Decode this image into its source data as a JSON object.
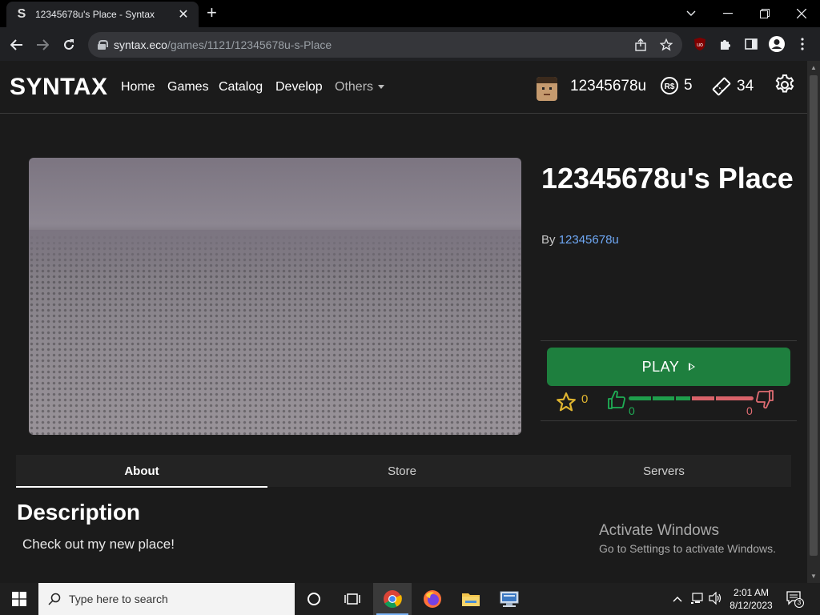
{
  "browser": {
    "tab_title": "12345678u's Place - Syntax",
    "tab_favicon": "S",
    "url_host": "syntax.eco",
    "url_path": "/games/1121/12345678u-s-Place"
  },
  "site": {
    "logo": "SYNTAX",
    "nav": [
      "Home",
      "Games",
      "Catalog",
      "Develop",
      "Others"
    ],
    "username": "12345678u",
    "robux": "5",
    "tix": "34"
  },
  "game": {
    "title": "12345678u's Place",
    "by_label": "By",
    "creator": "12345678u",
    "play_label": "PLAY",
    "favorites": "0",
    "upvotes": "0",
    "downvotes": "0"
  },
  "tabs": [
    "About",
    "Store",
    "Servers"
  ],
  "description": {
    "heading": "Description",
    "text": "Check out my new place!"
  },
  "watermark": {
    "line1": "Activate Windows",
    "line2": "Go to Settings to activate Windows."
  },
  "taskbar": {
    "search_placeholder": "Type here to search",
    "time": "2:01 AM",
    "date": "8/12/2023",
    "notifications": "3"
  },
  "colors": {
    "play_button": "#1e7f3e",
    "link": "#6fa8f5",
    "favorite_star": "#e0b530",
    "upvote": "#1f9e4c",
    "downvote": "#d9636a"
  }
}
